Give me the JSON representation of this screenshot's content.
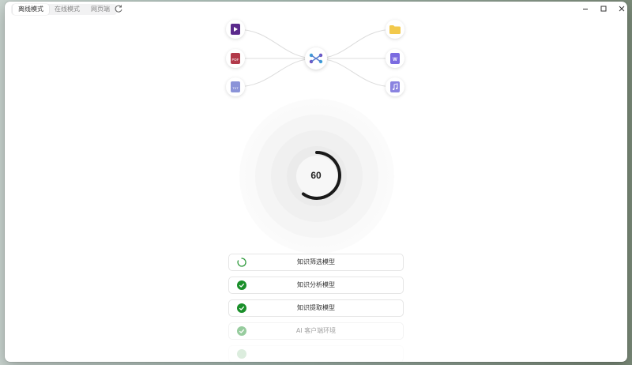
{
  "tabs": [
    {
      "label": "离线模式",
      "active": true
    },
    {
      "label": "在线模式",
      "active": false
    },
    {
      "label": "网页端",
      "active": false
    }
  ],
  "icons": {
    "left": [
      "video-file-icon",
      "pdf-file-icon",
      "txt-file-icon"
    ],
    "right": [
      "folder-icon",
      "word-file-icon",
      "audio-file-icon"
    ],
    "hub": "network-hub-icon"
  },
  "file_badges": {
    "pdf": "PDF",
    "txt": "TXT",
    "word": "W"
  },
  "progress": {
    "value": "60",
    "fraction": 0.6
  },
  "steps": [
    {
      "label": "知识筛选模型",
      "status": "loading"
    },
    {
      "label": "知识分析模型",
      "status": "done"
    },
    {
      "label": "知识提取模型",
      "status": "done"
    },
    {
      "label": "AI 客户端环境",
      "status": "done"
    }
  ],
  "colors": {
    "done": "#1a8f2a",
    "ring": "#1a1a1a",
    "purple": "#6b4fc2"
  }
}
